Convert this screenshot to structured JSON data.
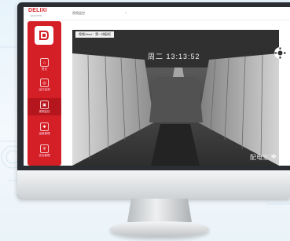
{
  "brand": {
    "logo_text": "DELIXI",
    "logo_sub": "ELECTRIC"
  },
  "topbar": {
    "breadcrumb": "视频监控"
  },
  "sidebar": {
    "items": [
      {
        "label": "首页",
        "icon": "home-icon"
      },
      {
        "label": "运行监测",
        "icon": "monitor-icon"
      },
      {
        "label": "视频监控",
        "icon": "camera-icon",
        "active": true
      },
      {
        "label": "运维管理",
        "icon": "tool-icon"
      },
      {
        "label": "安全管理",
        "icon": "shield-icon"
      }
    ]
  },
  "camera": {
    "panel_title": "视频Xbox：第一排配柜",
    "overlay_time": "周二 13:13:52",
    "overlay_name": "配电室2"
  },
  "colors": {
    "accent": "#d51f27",
    "bezel": "#2a2d31",
    "background": "#e7f3fb"
  }
}
